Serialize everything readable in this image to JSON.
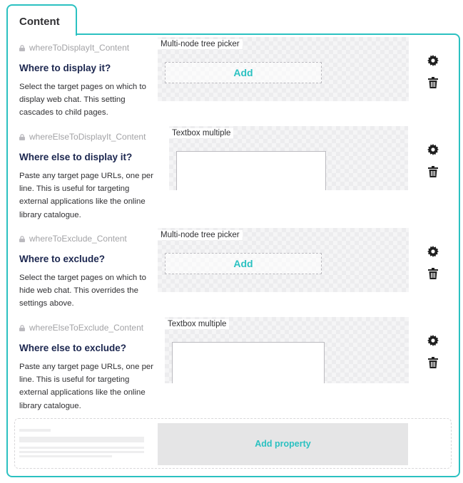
{
  "tab": {
    "label": "Content"
  },
  "colors": {
    "accent": "#2bc1c1",
    "heading": "#1b264f",
    "muted": "#a3a3a6"
  },
  "properties": [
    {
      "alias": "whereToDisplayIt_Content",
      "label": "Where to display it?",
      "description": "Select the target pages on which to display web chat. This setting cascades to child pages.",
      "editor": "Multi-node tree picker",
      "editor_type": "picker",
      "add_label": "Add"
    },
    {
      "alias": "whereElseToDisplayIt_Content",
      "label": "Where else to display it?",
      "description": "Paste any target page URLs, one per line. This is useful for targeting external applications like the online library catalogue.",
      "editor": "Textbox multiple",
      "editor_type": "textarea"
    },
    {
      "alias": "whereToExclude_Content",
      "label": "Where to exclude?",
      "description": "Select the target pages on which to hide web chat. This overrides the settings above.",
      "editor": "Multi-node tree picker",
      "editor_type": "picker",
      "add_label": "Add"
    },
    {
      "alias": "whereElseToExclude_Content",
      "label": "Where else to exclude?",
      "description": "Paste any target page URLs, one per line. This is useful for targeting external applications like the online library catalogue.",
      "editor": "Textbox multiple",
      "editor_type": "textarea"
    }
  ],
  "add_property": {
    "label": "Add property"
  },
  "icons": {
    "alias_lock": "lock-icon",
    "settings": "gear-icon",
    "delete": "trash-icon"
  }
}
